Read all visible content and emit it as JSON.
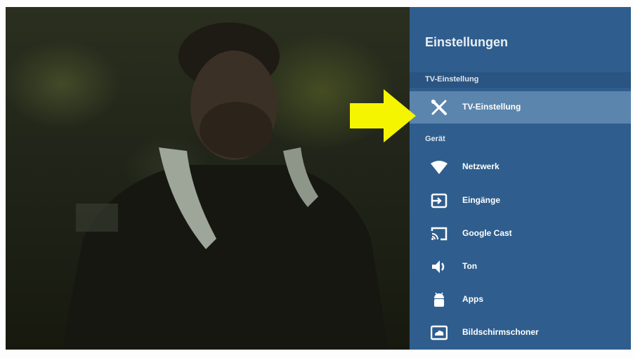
{
  "settings": {
    "title": "Einstellungen",
    "sections": [
      {
        "label": "TV-Einstellung"
      },
      {
        "label": "Gerät"
      }
    ],
    "items": [
      {
        "label": "TV-Einstellung",
        "icon": "tools-icon",
        "selected": true
      },
      {
        "label": "Netzwerk",
        "icon": "wifi-icon"
      },
      {
        "label": "Eingänge",
        "icon": "input-icon"
      },
      {
        "label": "Google Cast",
        "icon": "cast-icon"
      },
      {
        "label": "Ton",
        "icon": "speaker-icon"
      },
      {
        "label": "Apps",
        "icon": "android-icon"
      },
      {
        "label": "Bildschirmschoner",
        "icon": "screensaver-icon"
      }
    ]
  },
  "colors": {
    "panel": "#2f5e8e",
    "selected": "#5b85ad",
    "arrow": "#f5f500"
  }
}
